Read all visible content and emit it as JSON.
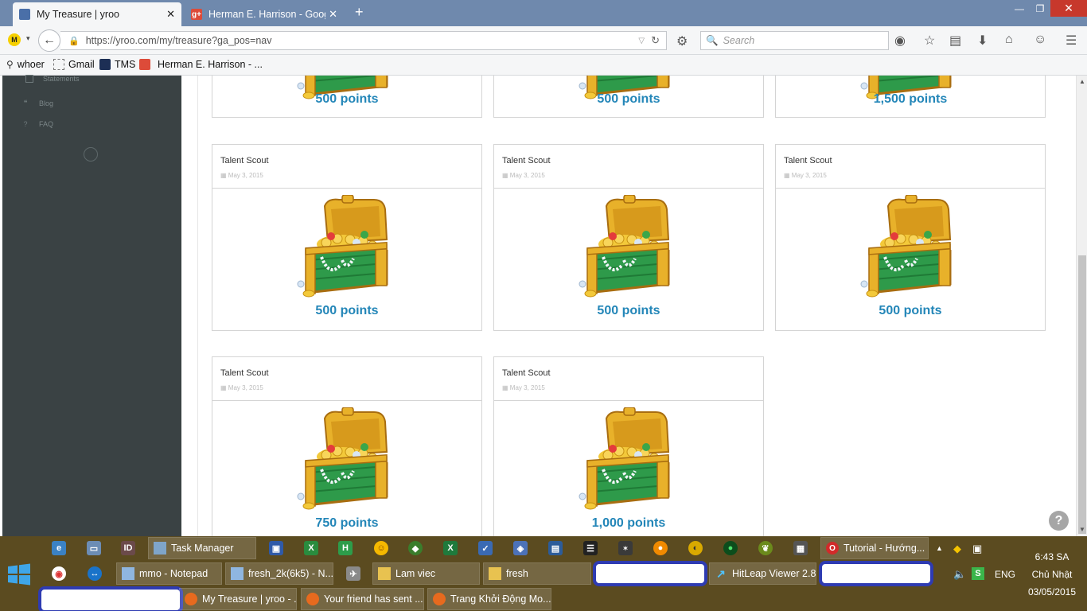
{
  "browser": {
    "tabs": [
      {
        "title": "My Treasure | yroo",
        "active": true,
        "icon": "yroo-icon"
      },
      {
        "title": "Herman E. Harrison - Goog...",
        "active": false,
        "icon": "google-plus-icon"
      }
    ],
    "new_tab_label": "+",
    "url": "https://yroo.com/my/treasure?ga_pos=nav",
    "search_placeholder": "Search",
    "bookmarks": [
      {
        "label": "whoer",
        "icon": "search-icon"
      },
      {
        "label": "Gmail",
        "icon": "blank-page-icon"
      },
      {
        "label": "TMS",
        "icon": "tms-icon"
      },
      {
        "label": "Herman E. Harrison - ...",
        "icon": "google-plus-icon"
      }
    ]
  },
  "sidebar": {
    "items": [
      {
        "label": "Statements",
        "icon": "document-icon"
      },
      {
        "label": "Blog",
        "icon": "quote-icon"
      },
      {
        "label": "FAQ",
        "icon": "question-icon"
      }
    ]
  },
  "treasure": {
    "top_row_points": [
      "500 points",
      "500 points",
      "1,500 points"
    ],
    "cards": [
      {
        "title": "Talent Scout",
        "date": "May 3, 2015",
        "points": "500 points"
      },
      {
        "title": "Talent Scout",
        "date": "May 3, 2015",
        "points": "500 points"
      },
      {
        "title": "Talent Scout",
        "date": "May 3, 2015",
        "points": "500 points"
      },
      {
        "title": "Talent Scout",
        "date": "May 3, 2015",
        "points": "750 points"
      },
      {
        "title": "Talent Scout",
        "date": "May 3, 2015",
        "points": "1,000 points"
      }
    ],
    "accent_color": "#2386b8"
  },
  "help_label": "?",
  "taskbar": {
    "top_row": [
      {
        "label": "Task Manager",
        "icon": "task-manager-icon"
      },
      {
        "label": "Tutorial - Hướng...",
        "icon": "opera-icon"
      }
    ],
    "middle_row": [
      {
        "label": "mmo - Notepad",
        "icon": "notepad-icon"
      },
      {
        "label": "fresh_2k(6k5) - N...",
        "icon": "notepad-icon"
      },
      {
        "label": "Lam viec",
        "icon": "folder-icon"
      },
      {
        "label": "fresh",
        "icon": "folder-icon"
      },
      {
        "label": "HitLeap Viewer 2.8",
        "icon": "hitleap-icon"
      }
    ],
    "bottom_row": [
      {
        "label": "My Treasure | yroo - ...",
        "icon": "firefox-icon"
      },
      {
        "label": "Your friend has sent ...",
        "icon": "firefox-icon"
      },
      {
        "label": "Trang Khởi Động Mo...",
        "icon": "firefox-icon"
      }
    ],
    "tray": {
      "language": "ENG",
      "time": "6:43 SA",
      "day": "Chủ Nhật",
      "date": "03/05/2015"
    }
  }
}
